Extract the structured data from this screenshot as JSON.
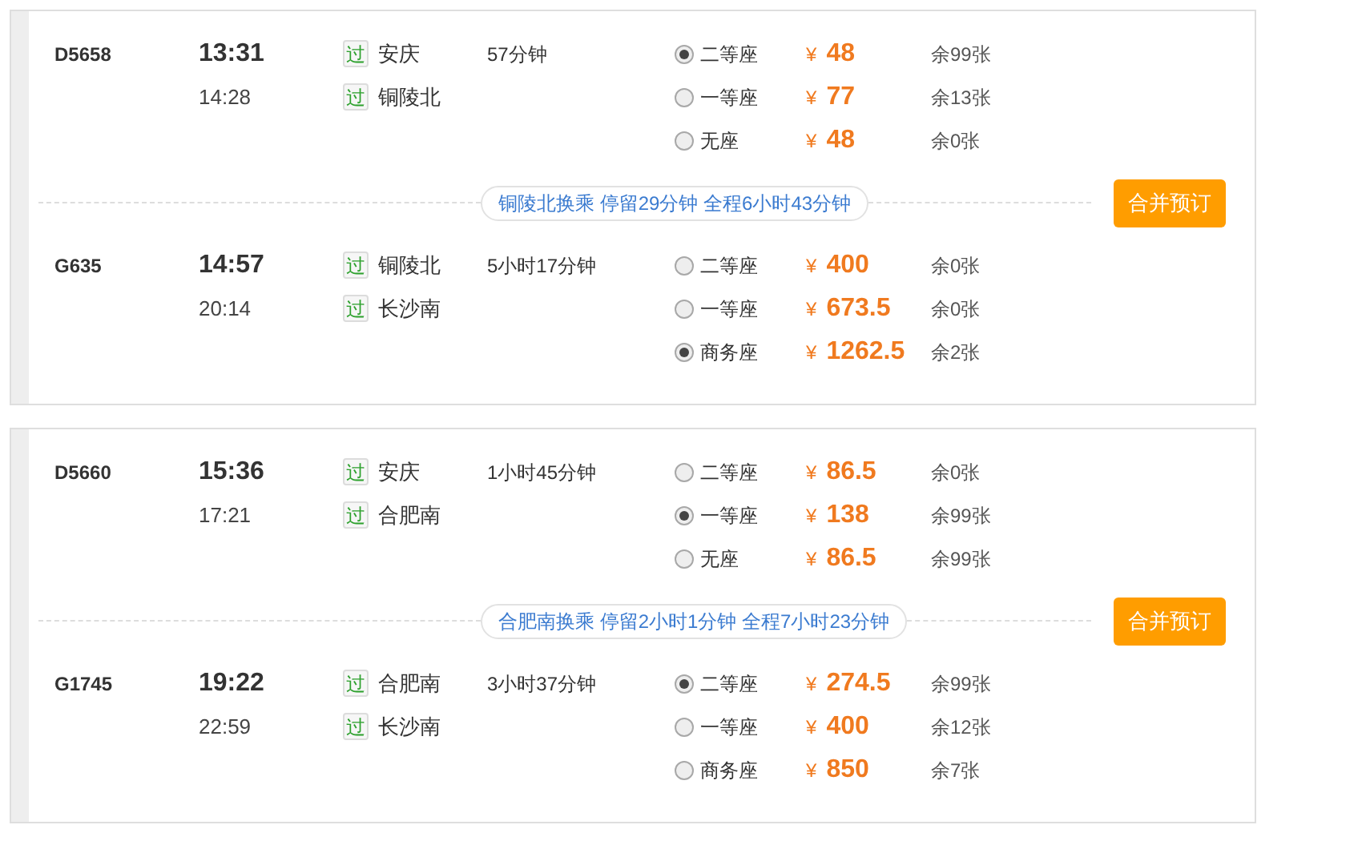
{
  "itineraries": [
    {
      "legs": [
        {
          "train": "D5658",
          "depart_time": "13:31",
          "arrive_time": "14:28",
          "stations": [
            {
              "tag": "过",
              "name": "安庆"
            },
            {
              "tag": "过",
              "name": "铜陵北"
            }
          ],
          "duration": "57分钟",
          "seats": [
            {
              "class": "二等座",
              "currency": "¥",
              "price": "48",
              "remaining": "余99张",
              "selected": true
            },
            {
              "class": "一等座",
              "currency": "¥",
              "price": "77",
              "remaining": "余13张",
              "selected": false
            },
            {
              "class": "无座",
              "currency": "¥",
              "price": "48",
              "remaining": "余0张",
              "selected": false
            }
          ]
        },
        {
          "train": "G635",
          "depart_time": "14:57",
          "arrive_time": "20:14",
          "stations": [
            {
              "tag": "过",
              "name": "铜陵北"
            },
            {
              "tag": "过",
              "name": "长沙南"
            }
          ],
          "duration": "5小时17分钟",
          "seats": [
            {
              "class": "二等座",
              "currency": "¥",
              "price": "400",
              "remaining": "余0张",
              "selected": false
            },
            {
              "class": "一等座",
              "currency": "¥",
              "price": "673.5",
              "remaining": "余0张",
              "selected": false
            },
            {
              "class": "商务座",
              "currency": "¥",
              "price": "1262.5",
              "remaining": "余2张",
              "selected": true
            }
          ]
        }
      ],
      "transfer": "铜陵北换乘 停留29分钟 全程6小时43分钟",
      "book_button": "合并预订"
    },
    {
      "legs": [
        {
          "train": "D5660",
          "depart_time": "15:36",
          "arrive_time": "17:21",
          "stations": [
            {
              "tag": "过",
              "name": "安庆"
            },
            {
              "tag": "过",
              "name": "合肥南"
            }
          ],
          "duration": "1小时45分钟",
          "seats": [
            {
              "class": "二等座",
              "currency": "¥",
              "price": "86.5",
              "remaining": "余0张",
              "selected": false
            },
            {
              "class": "一等座",
              "currency": "¥",
              "price": "138",
              "remaining": "余99张",
              "selected": true
            },
            {
              "class": "无座",
              "currency": "¥",
              "price": "86.5",
              "remaining": "余99张",
              "selected": false
            }
          ]
        },
        {
          "train": "G1745",
          "depart_time": "19:22",
          "arrive_time": "22:59",
          "stations": [
            {
              "tag": "过",
              "name": "合肥南"
            },
            {
              "tag": "过",
              "name": "长沙南"
            }
          ],
          "duration": "3小时37分钟",
          "seats": [
            {
              "class": "二等座",
              "currency": "¥",
              "price": "274.5",
              "remaining": "余99张",
              "selected": true
            },
            {
              "class": "一等座",
              "currency": "¥",
              "price": "400",
              "remaining": "余12张",
              "selected": false
            },
            {
              "class": "商务座",
              "currency": "¥",
              "price": "850",
              "remaining": "余7张",
              "selected": false
            }
          ]
        }
      ],
      "transfer": "合肥南换乘 停留2小时1分钟 全程7小时23分钟",
      "book_button": "合并预订"
    }
  ]
}
